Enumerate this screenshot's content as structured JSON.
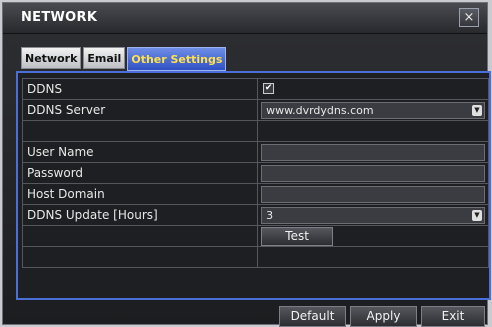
{
  "window": {
    "title": "NETWORK",
    "close_symbol": "×"
  },
  "tabs": [
    {
      "label": "Network",
      "active": false
    },
    {
      "label": "Email",
      "active": false
    },
    {
      "label": "Other Settings",
      "active": true
    }
  ],
  "form": {
    "ddns_label": "DDNS",
    "ddns_checked": true,
    "ddns_server_label": "DDNS Server",
    "ddns_server_value": "www.dvrdydns.com",
    "user_name_label": "User Name",
    "user_name_value": "",
    "password_label": "Password",
    "password_value": "",
    "host_domain_label": "Host Domain",
    "host_domain_value": "",
    "update_label": "DDNS Update [Hours]",
    "update_value": "3",
    "test_label": "Test"
  },
  "footer": {
    "default_label": "Default",
    "apply_label": "Apply",
    "exit_label": "Exit"
  },
  "colors": {
    "accent_blue": "#3f5fd0",
    "active_tab_text": "#ffe24a",
    "window_background": "#1e1f22"
  }
}
